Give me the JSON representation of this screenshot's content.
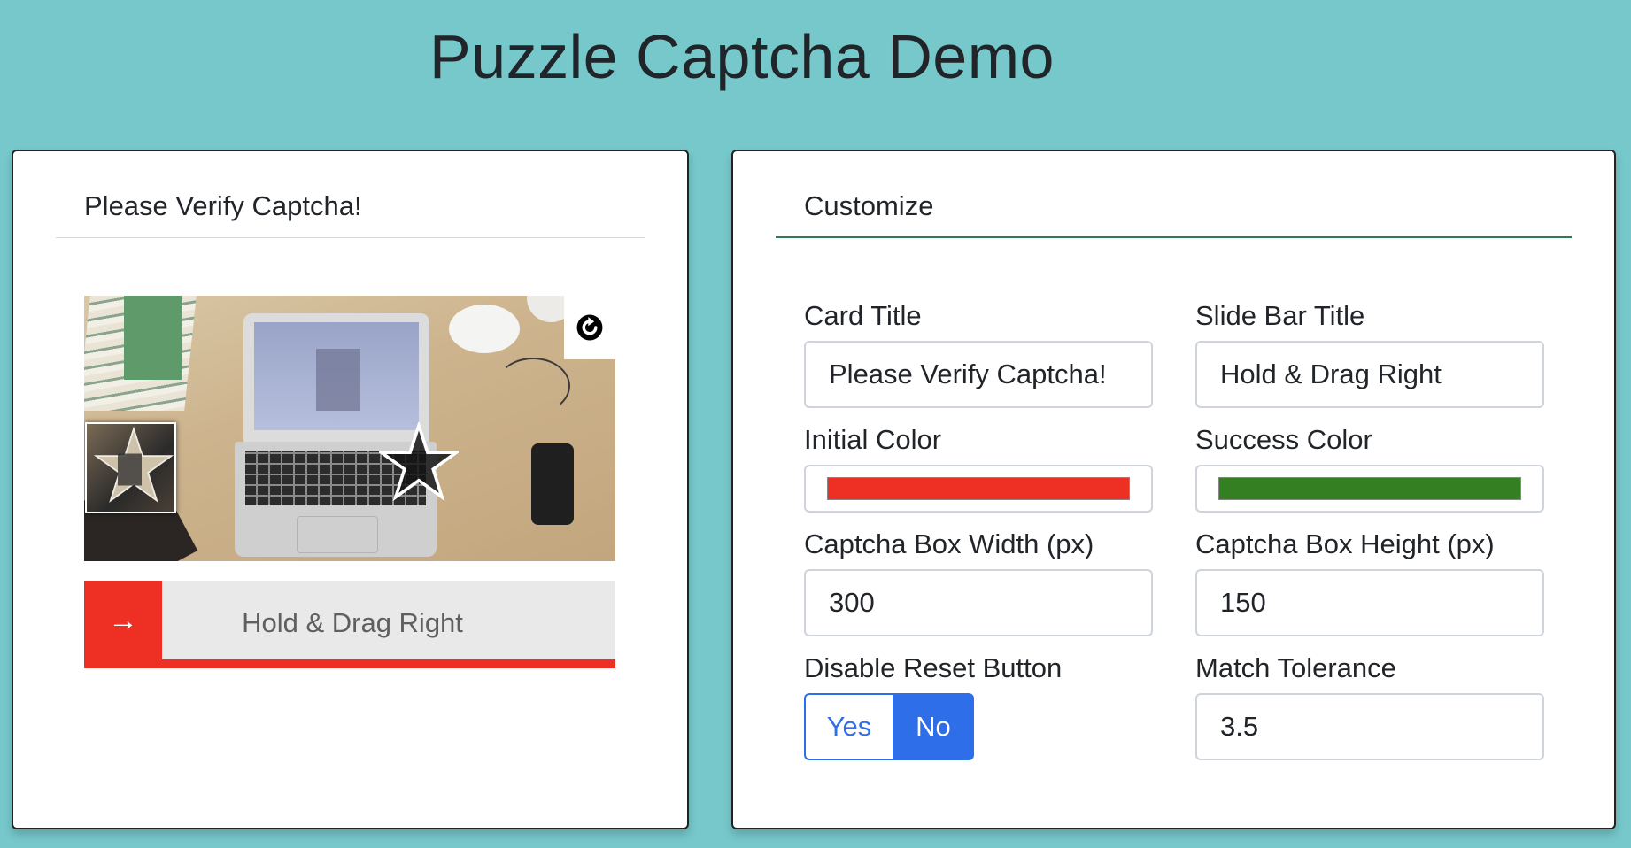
{
  "page": {
    "title": "Puzzle Captcha Demo",
    "background_color": "#76c8cb"
  },
  "captcha_card": {
    "title": "Please Verify Captcha!",
    "reset_icon": "refresh-icon",
    "target_icon": "star-outline-icon",
    "slide_bar": {
      "title": "Hold & Drag Right",
      "handle_icon": "arrow-right-icon",
      "color": "#ee3024",
      "position": 0
    }
  },
  "customize_card": {
    "title": "Customize",
    "fields": {
      "card_title": {
        "label": "Card Title",
        "value": "Please Verify Captcha!"
      },
      "slide_bar_title": {
        "label": "Slide Bar Title",
        "value": "Hold & Drag Right"
      },
      "initial_color": {
        "label": "Initial Color",
        "value": "#ee3024"
      },
      "success_color": {
        "label": "Success Color",
        "value": "#347f22"
      },
      "captcha_box_width": {
        "label": "Captcha Box Width (px)",
        "value": "300"
      },
      "captcha_box_height": {
        "label": "Captcha Box Height (px)",
        "value": "150"
      },
      "disable_reset_button": {
        "label": "Disable Reset Button",
        "options": [
          "Yes",
          "No"
        ],
        "selected": "No"
      },
      "match_tolerance": {
        "label": "Match Tolerance",
        "value": "3.5"
      }
    }
  }
}
